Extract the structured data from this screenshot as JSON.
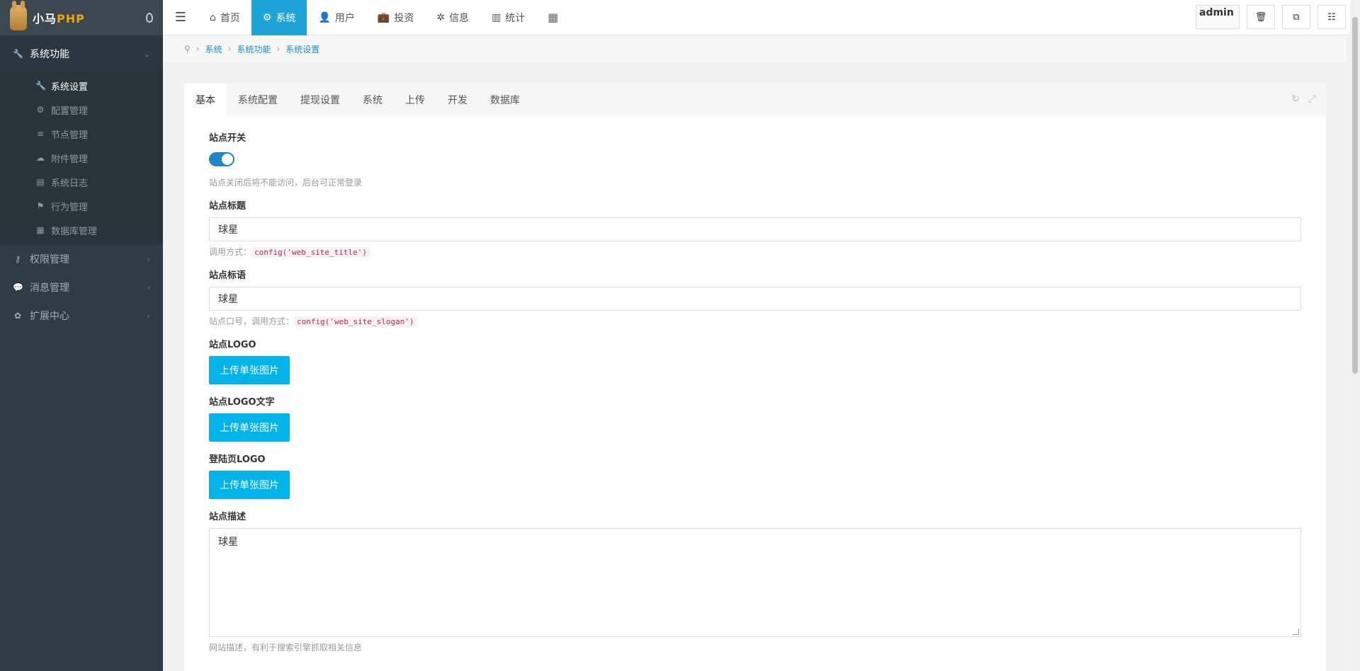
{
  "sidebar": {
    "logo_left": "小马",
    "logo_right": "PHP",
    "group": {
      "label": "系统功能"
    },
    "sub_items": [
      {
        "label": "系统设置",
        "icon": "wrench-icon"
      },
      {
        "label": "配置管理",
        "icon": "gears-icon"
      },
      {
        "label": "节点管理",
        "icon": "list-icon"
      },
      {
        "label": "附件管理",
        "icon": "cloud-upload-icon"
      },
      {
        "label": "系统日志",
        "icon": "book-icon"
      },
      {
        "label": "行为管理",
        "icon": "flag-icon"
      },
      {
        "label": "数据库管理",
        "icon": "database-icon"
      }
    ],
    "items": [
      {
        "label": "权限管理",
        "icon": "key-icon"
      },
      {
        "label": "消息管理",
        "icon": "chat-icon"
      },
      {
        "label": "扩展中心",
        "icon": "puzzle-icon"
      }
    ]
  },
  "topbar": {
    "nav": [
      {
        "label": "首页",
        "icon": "home-icon"
      },
      {
        "label": "系统",
        "icon": "gear-icon"
      },
      {
        "label": "用户",
        "icon": "user-icon"
      },
      {
        "label": "投资",
        "icon": "briefcase-icon"
      },
      {
        "label": "信息",
        "icon": "yelp-icon"
      },
      {
        "label": "统计",
        "icon": "bar-chart-icon"
      }
    ],
    "avatar_alt": "admin"
  },
  "breadcrumb": [
    "系统",
    "系统功能",
    "系统设置"
  ],
  "tabs": [
    "基本",
    "系统配置",
    "提现设置",
    "系统",
    "上传",
    "开发",
    "数据库"
  ],
  "form": {
    "site_switch": {
      "label": "站点开关",
      "help": "站点关闭后将不能访问，后台可正常登录",
      "on": true
    },
    "site_title": {
      "label": "站点标题",
      "value": "球星",
      "help_prefix": "调用方式：",
      "help_code": "config('web_site_title')"
    },
    "site_slogan": {
      "label": "站点标语",
      "value": "球星",
      "help_prefix": "站点口号，调用方式：",
      "help_code": "config('web_site_slogan')"
    },
    "site_logo": {
      "label": "站点LOGO",
      "button": "上传单张图片"
    },
    "site_logo_text": {
      "label": "站点LOGO文字",
      "button": "上传单张图片"
    },
    "login_logo": {
      "label": "登陆页LOGO",
      "button": "上传单张图片"
    },
    "site_desc": {
      "label": "站点描述",
      "value": "球星",
      "help": "网站描述，有利于搜索引擎抓取相关信息"
    }
  }
}
